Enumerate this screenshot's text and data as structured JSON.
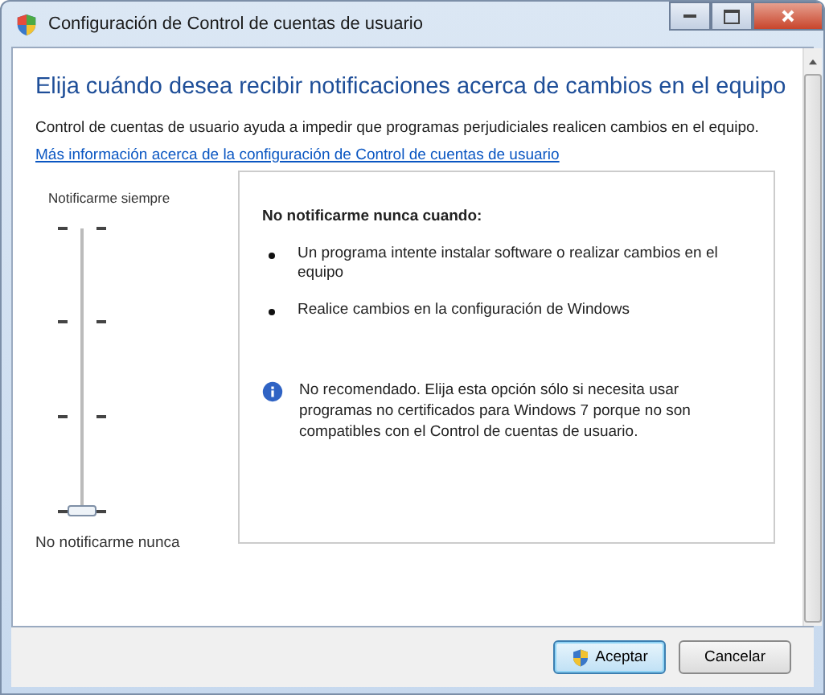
{
  "window": {
    "title": "Configuración de Control de cuentas de usuario"
  },
  "heading": "Elija cuándo desea recibir notificaciones acerca de cambios en el equipo",
  "description": "Control de cuentas de usuario ayuda a impedir que programas perjudiciales realicen cambios en el equipo.",
  "link": "Más información acerca de la configuración de Control de cuentas de usuario",
  "slider": {
    "top_label": "Notificarme siempre",
    "bottom_label": "No notificarme nunca",
    "level": 0
  },
  "panel": {
    "title": "No notificarme nunca cuando:",
    "bullets": [
      "Un programa intente instalar software o realizar cambios en el equipo",
      "Realice cambios en la configuración de Windows"
    ],
    "note": "No recomendado. Elija esta opción sólo si necesita usar programas no certificados para Windows 7 porque no son compatibles con el Control de cuentas de usuario."
  },
  "buttons": [
    {
      "label": "Aceptar",
      "default": true,
      "shield": true
    },
    {
      "label": "Cancelar",
      "default": false,
      "shield": false
    }
  ]
}
